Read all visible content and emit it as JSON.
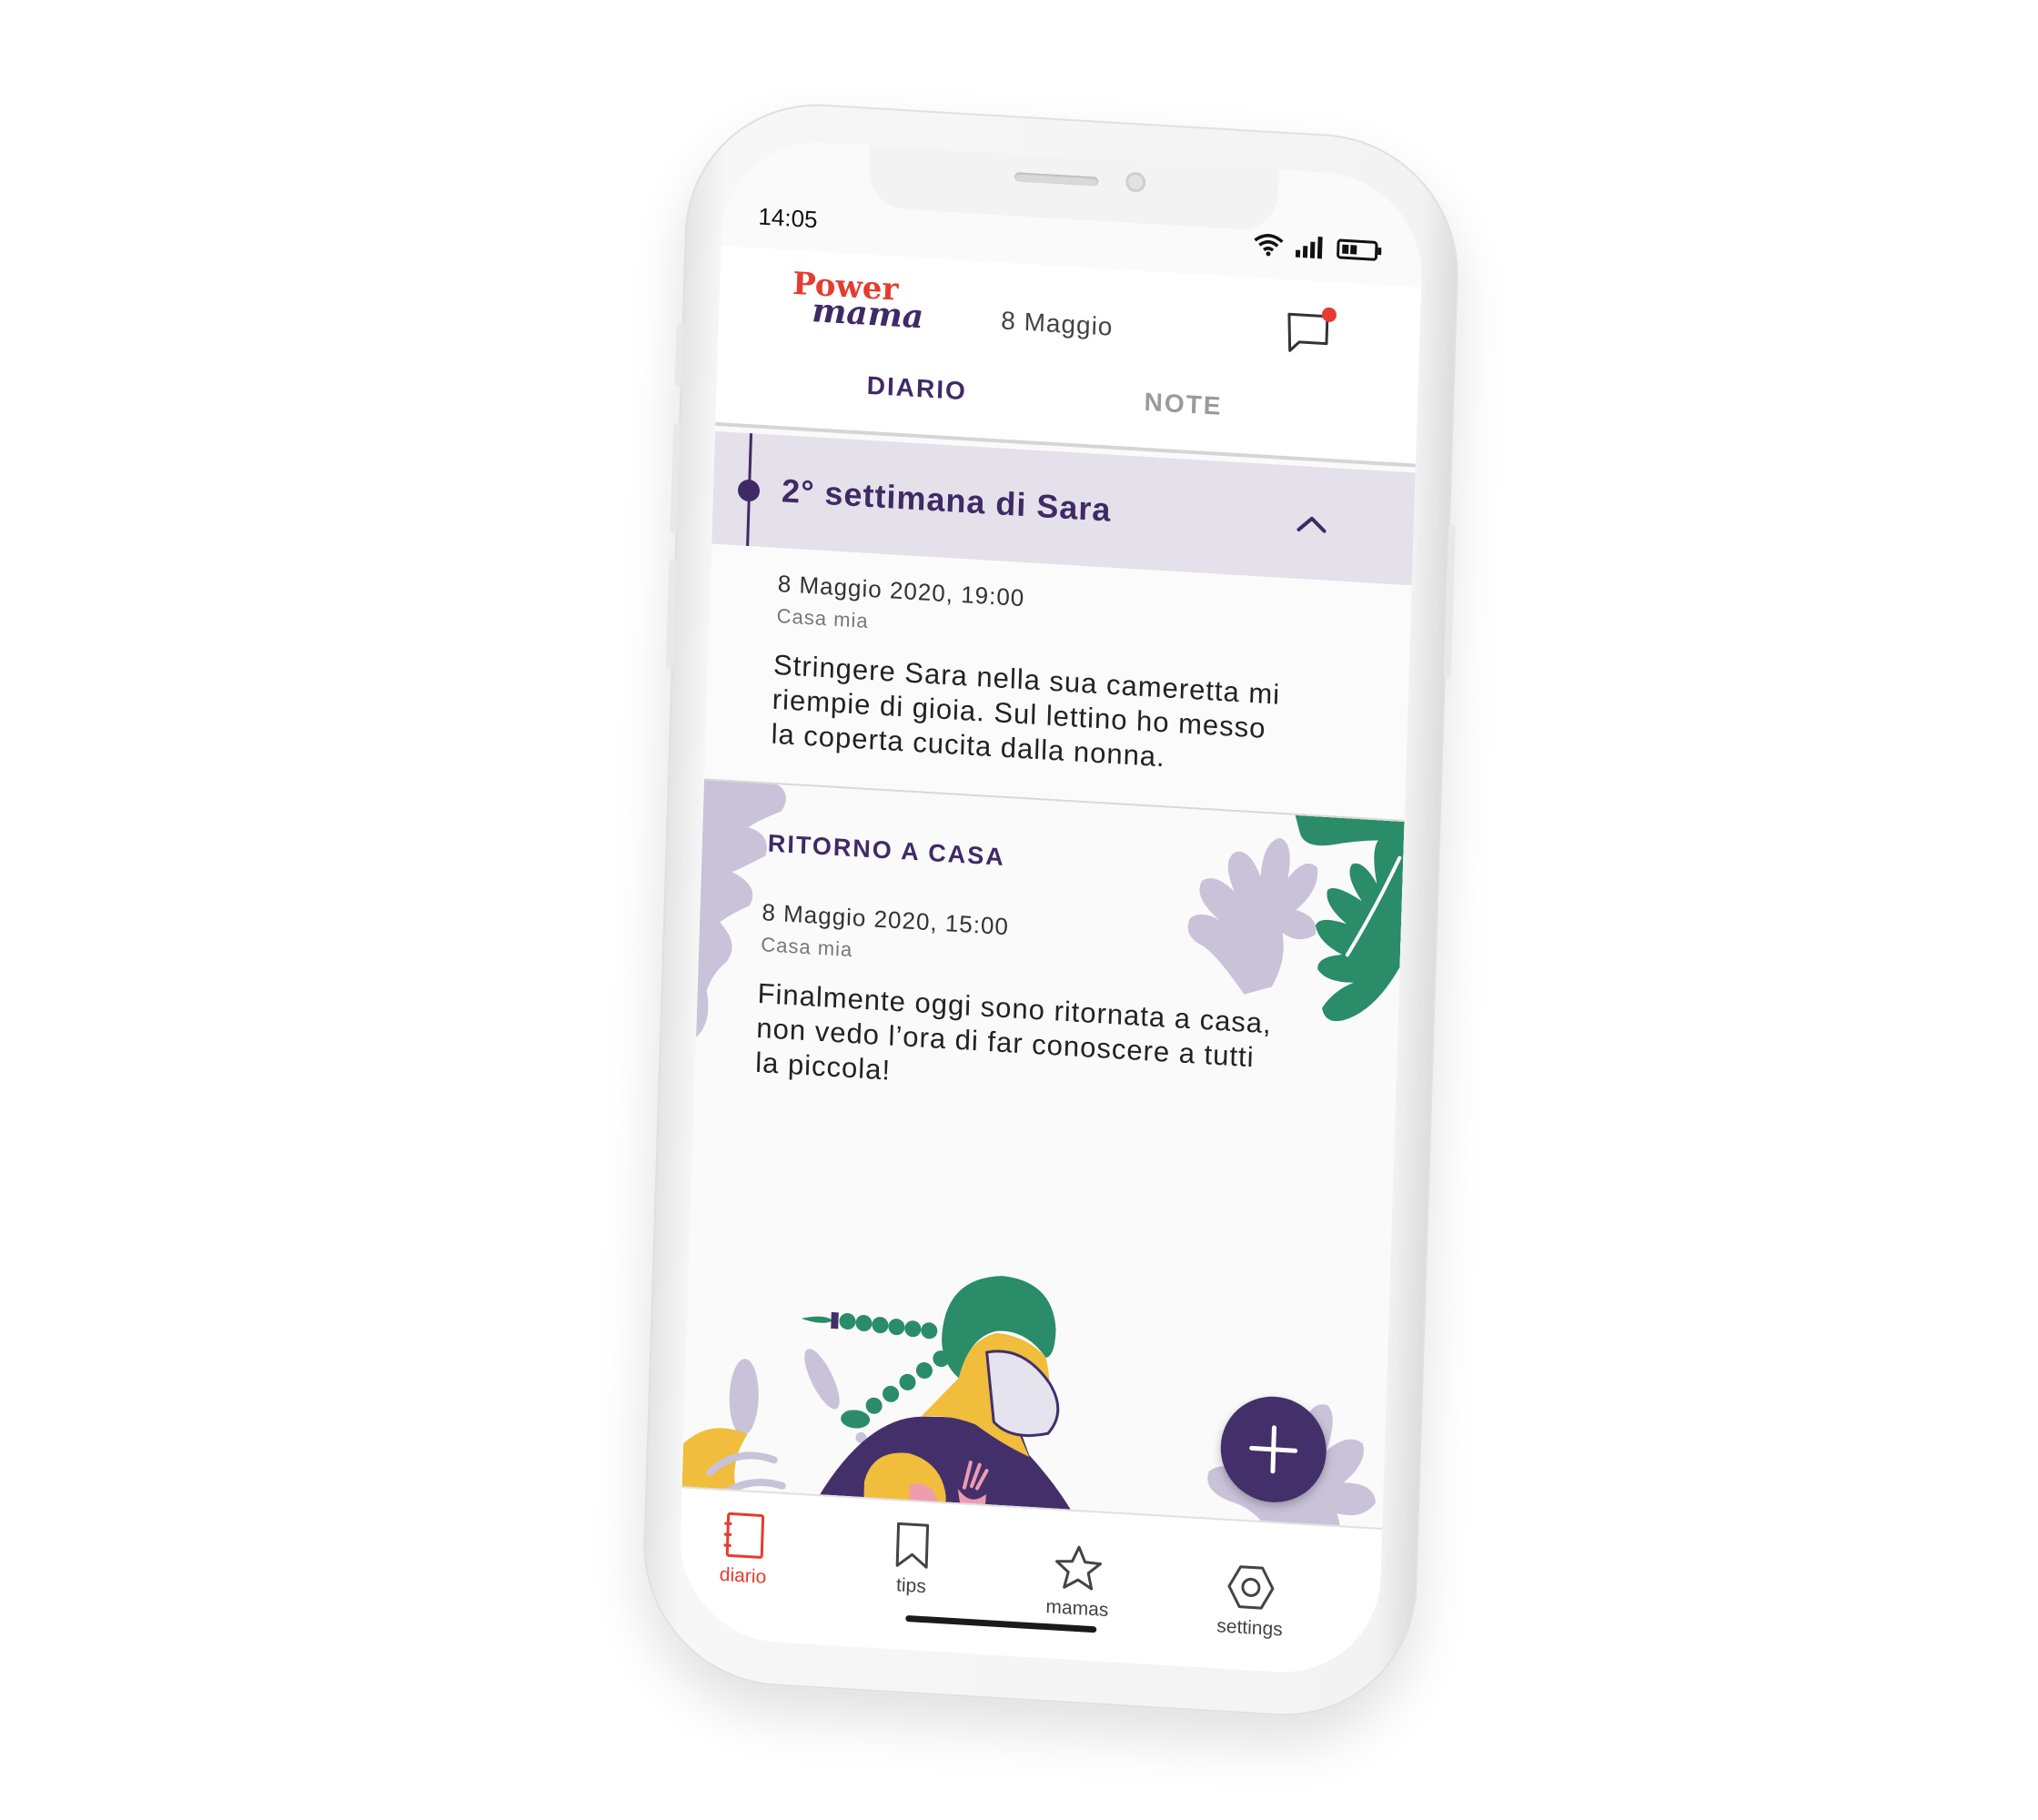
{
  "status_bar": {
    "time": "14:05"
  },
  "header": {
    "logo_top": "Power",
    "logo_bottom": "mama",
    "date": "8 Maggio"
  },
  "tabs": [
    {
      "label": "DIARIO",
      "active": true
    },
    {
      "label": "NOTE",
      "active": false
    }
  ],
  "week": {
    "title": "2° settimana di Sara"
  },
  "entries": [
    {
      "title": "",
      "date": "8 Maggio 2020, 19:00",
      "place": "Casa mia",
      "text_lines": [
        "Stringere Sara nella sua cameretta mi",
        "riempie di gioia. Sul lettino ho messo",
        "la coperta cucita dalla nonna."
      ]
    },
    {
      "title": "RITORNO A CASA",
      "date": "8 Maggio 2020, 15:00",
      "place": "Casa mia",
      "text_lines": [
        "Finalmente oggi sono ritornata a casa,",
        "non vedo l’ora di far conoscere a tutti",
        "la piccola!"
      ]
    }
  ],
  "bottom_nav": [
    {
      "label": "diario",
      "icon": "notebook-icon",
      "active": true
    },
    {
      "label": "tips",
      "icon": "bookmark-icon",
      "active": false
    },
    {
      "label": "mamas",
      "icon": "star-icon",
      "active": false
    },
    {
      "label": "settings",
      "icon": "hexagon-gear-icon",
      "active": false
    }
  ],
  "colors": {
    "brand_red": "#e63b2e",
    "brand_purple": "#3f2a66",
    "leaf_lilac": "#c9c2d8",
    "leaf_green": "#2a8c68",
    "skin_yellow": "#f0bd3c"
  }
}
